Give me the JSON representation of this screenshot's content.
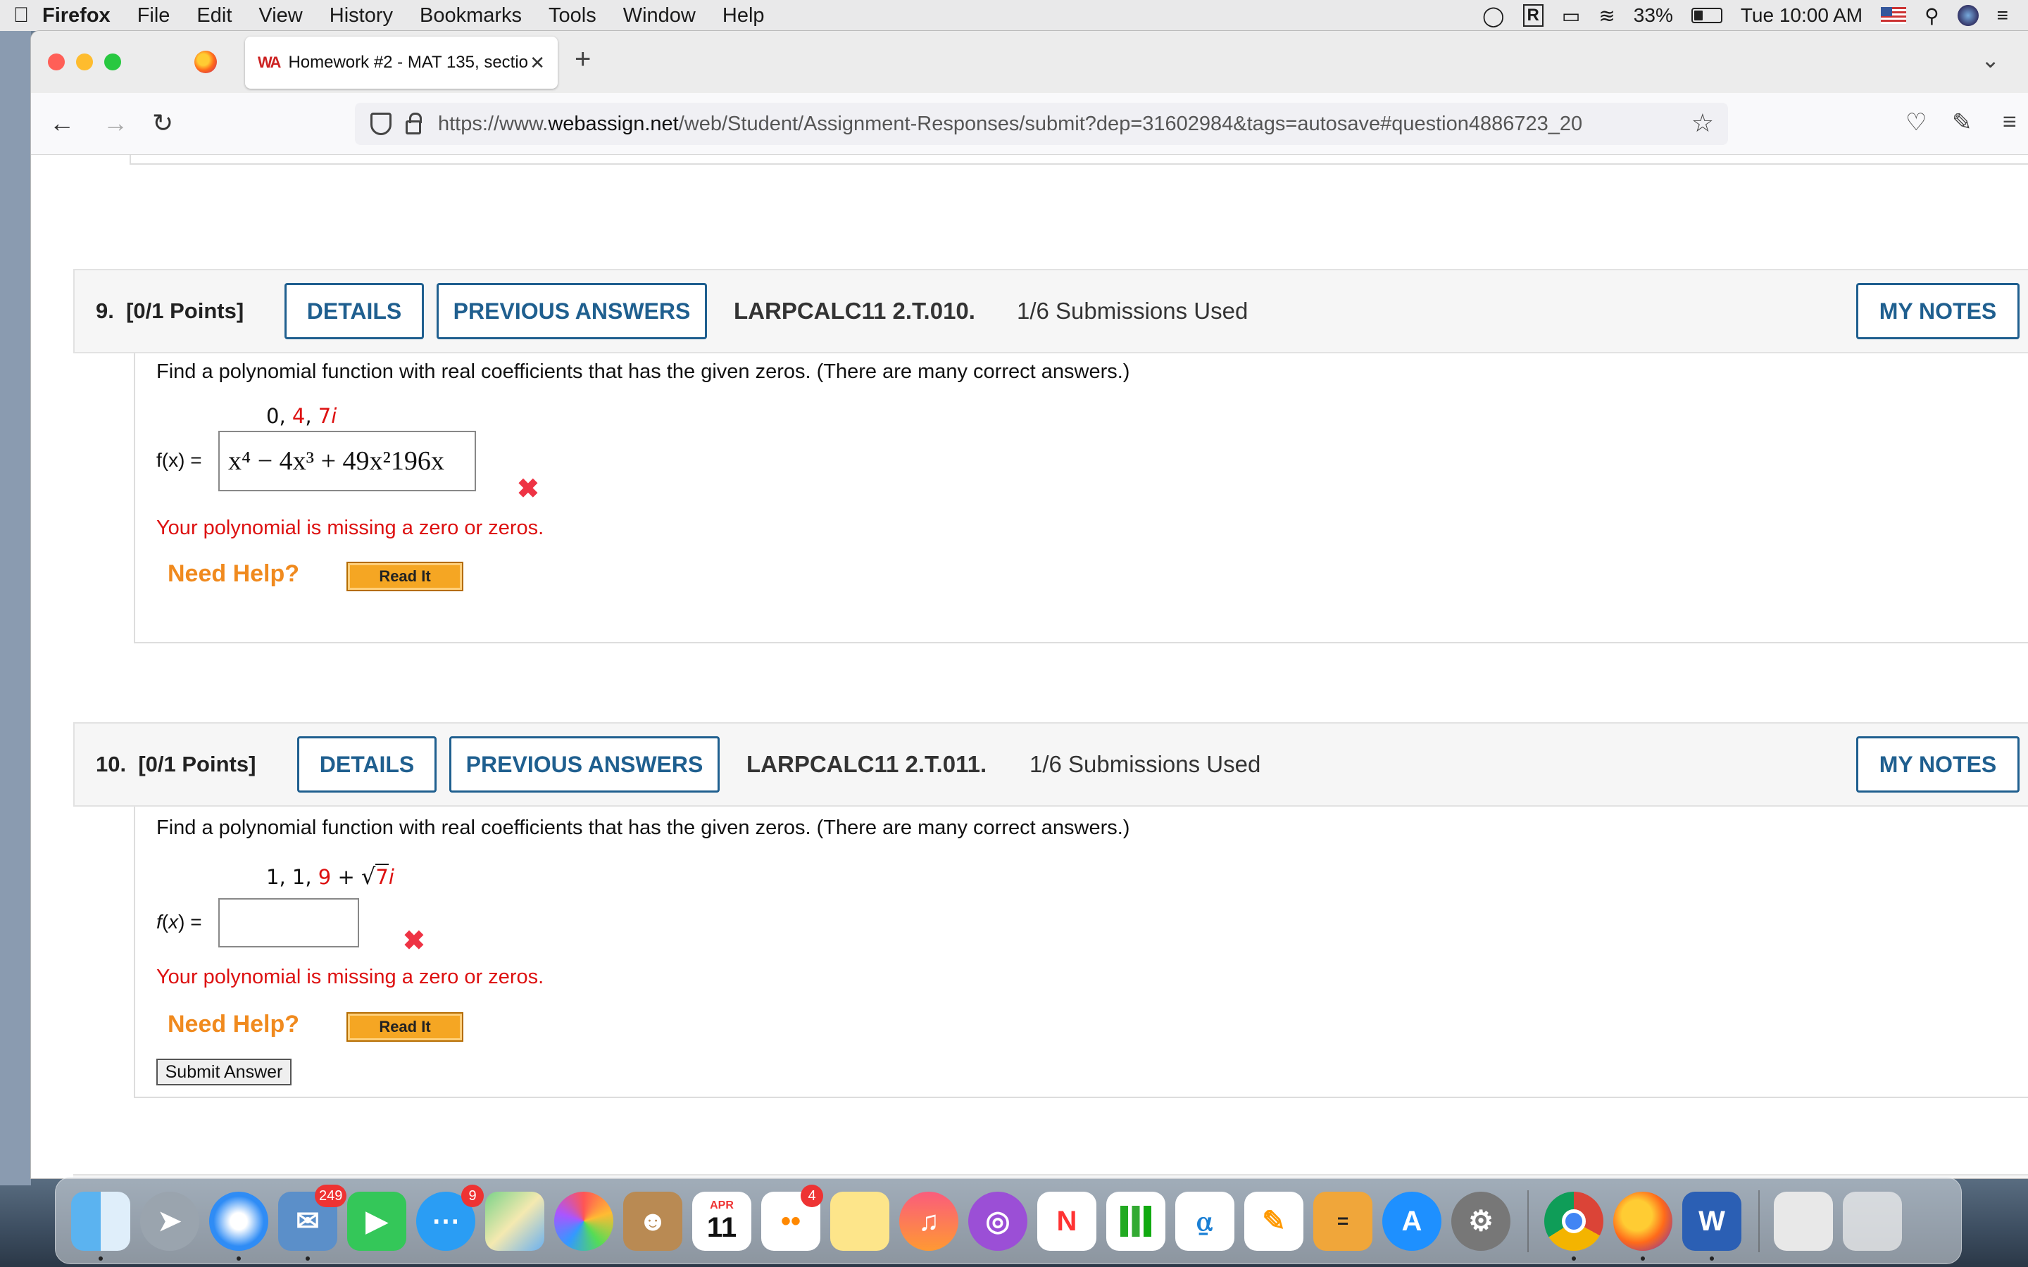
{
  "menubar": {
    "app": "Firefox",
    "items": [
      "File",
      "Edit",
      "View",
      "History",
      "Bookmarks",
      "Tools",
      "Window",
      "Help"
    ],
    "battery": "33%",
    "clock": "Tue 10:00 AM"
  },
  "browser": {
    "tab_title": "Homework #2 - MAT 135, sectio",
    "tab_logo": "WA",
    "url_prefix": "https://www.",
    "url_host": "webassign.net",
    "url_path": "/web/Student/Assignment-Responses/submit?dep=31602984&tags=autosave#question4886723_20"
  },
  "questions": [
    {
      "number": "9.",
      "points": "[0/1 Points]",
      "details_label": "DETAILS",
      "prev_answers_label": "PREVIOUS ANSWERS",
      "code": "LARPCALC11 2.T.010.",
      "submissions": "1/6 Submissions Used",
      "my_notes_label": "MY NOTES",
      "prompt": "Find a polynomial function with real coefficients that has the given zeros. (There are many correct answers.)",
      "zeros_a": "0, ",
      "zeros_b": "4",
      "zeros_c": ", ",
      "zeros_d": "7",
      "zeros_e": "i",
      "fx_label": "f(x) =",
      "answer": "x⁴ − 4x³ + 49x²196x",
      "feedback": "Your polynomial is missing a zero or zeros.",
      "need_help": "Need Help?",
      "read_it": "Read It"
    },
    {
      "number": "10.",
      "points": "[0/1 Points]",
      "details_label": "DETAILS",
      "prev_answers_label": "PREVIOUS ANSWERS",
      "code": "LARPCALC11 2.T.011.",
      "submissions": "1/6 Submissions Used",
      "my_notes_label": "MY NOTES",
      "prompt": "Find a polynomial function with real coefficients that has the given zeros. (There are many correct answers.)",
      "zeros_a": "1, 1, ",
      "zeros_b": "9",
      "zeros_c": " + ",
      "zeros_root": "7",
      "zeros_e": "i",
      "fx_label": "f(x) =",
      "answer": "",
      "feedback": "Your polynomial is missing a zero or zeros.",
      "need_help": "Need Help?",
      "read_it": "Read It",
      "submit_label": "Submit Answer"
    }
  ],
  "dock": {
    "mail_badge": "249",
    "messages_badge": "9",
    "reminders_badge": "4",
    "calendar_month": "APR",
    "calendar_day": "11"
  },
  "colors": {
    "accent_blue": "#1f5f8f",
    "error_red": "#d11111",
    "help_orange": "#f08a1e"
  }
}
